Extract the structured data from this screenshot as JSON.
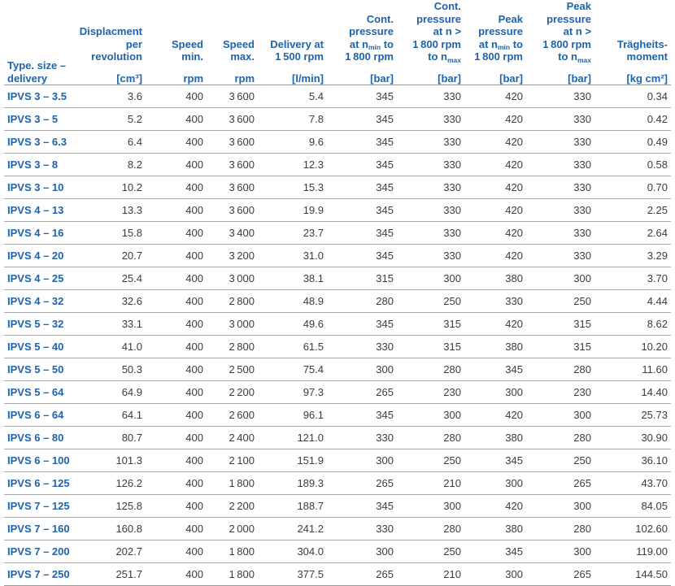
{
  "table": {
    "columns": [
      {
        "key": "type",
        "title_lines": [
          "Type. size –",
          "delivery"
        ],
        "unit": ""
      },
      {
        "key": "disp",
        "title_lines": [
          "Displacment",
          "per revolution"
        ],
        "unit": "[cm³]"
      },
      {
        "key": "smin",
        "title_lines": [
          "Speed",
          "min."
        ],
        "unit": "rpm"
      },
      {
        "key": "smax",
        "title_lines": [
          "Speed",
          "max."
        ],
        "unit": "rpm"
      },
      {
        "key": "del",
        "title_lines": [
          "Delivery at",
          "1 500 rpm"
        ],
        "unit": "[l/min]"
      },
      {
        "key": "cp1",
        "title_lines": [
          "Cont.",
          "pressure",
          "at n_min to",
          "1 800 rpm"
        ],
        "unit": "[bar]"
      },
      {
        "key": "cp2",
        "title_lines": [
          "Cont.",
          "pressure",
          "at n >",
          "1 800 rpm",
          "to n_max"
        ],
        "unit": "[bar]"
      },
      {
        "key": "pp1",
        "title_lines": [
          "Peak",
          "pressure",
          "at n_min to",
          "1 800 rpm"
        ],
        "unit": "[bar]"
      },
      {
        "key": "pp2",
        "title_lines": [
          "Peak",
          "pressure",
          "at n >",
          "1 800 rpm",
          "to n_max"
        ],
        "unit": "[bar]"
      },
      {
        "key": "tm",
        "title_lines": [
          "Trägheits-",
          "moment"
        ],
        "unit": "[kg cm²]"
      }
    ],
    "rows": [
      {
        "type": "IPVS 3 – 3.5",
        "disp": "3.6",
        "smin": "400",
        "smax": "3 600",
        "del": "5.4",
        "cp1": "345",
        "cp2": "330",
        "pp1": "420",
        "pp2": "330",
        "tm": "0.34"
      },
      {
        "type": "IPVS 3 – 5",
        "disp": "5.2",
        "smin": "400",
        "smax": "3 600",
        "del": "7.8",
        "cp1": "345",
        "cp2": "330",
        "pp1": "420",
        "pp2": "330",
        "tm": "0.42"
      },
      {
        "type": "IPVS 3 – 6.3",
        "disp": "6.4",
        "smin": "400",
        "smax": "3 600",
        "del": "9.6",
        "cp1": "345",
        "cp2": "330",
        "pp1": "420",
        "pp2": "330",
        "tm": "0.49"
      },
      {
        "type": "IPVS 3 – 8",
        "disp": "8.2",
        "smin": "400",
        "smax": "3 600",
        "del": "12.3",
        "cp1": "345",
        "cp2": "330",
        "pp1": "420",
        "pp2": "330",
        "tm": "0.58"
      },
      {
        "type": "IPVS 3 – 10",
        "disp": "10.2",
        "smin": "400",
        "smax": "3 600",
        "del": "15.3",
        "cp1": "345",
        "cp2": "330",
        "pp1": "420",
        "pp2": "330",
        "tm": "0.70"
      },
      {
        "type": "IPVS 4 – 13",
        "disp": "13.3",
        "smin": "400",
        "smax": "3 600",
        "del": "19.9",
        "cp1": "345",
        "cp2": "330",
        "pp1": "420",
        "pp2": "330",
        "tm": "2.25"
      },
      {
        "type": "IPVS 4 – 16",
        "disp": "15.8",
        "smin": "400",
        "smax": "3 400",
        "del": "23.7",
        "cp1": "345",
        "cp2": "330",
        "pp1": "420",
        "pp2": "330",
        "tm": "2.64"
      },
      {
        "type": "IPVS 4 – 20",
        "disp": "20.7",
        "smin": "400",
        "smax": "3 200",
        "del": "31.0",
        "cp1": "345",
        "cp2": "330",
        "pp1": "420",
        "pp2": "330",
        "tm": "3.29"
      },
      {
        "type": "IPVS 4 – 25",
        "disp": "25.4",
        "smin": "400",
        "smax": "3 000",
        "del": "38.1",
        "cp1": "315",
        "cp2": "300",
        "pp1": "380",
        "pp2": "300",
        "tm": "3.70"
      },
      {
        "type": "IPVS 4 – 32",
        "disp": "32.6",
        "smin": "400",
        "smax": "2 800",
        "del": "48.9",
        "cp1": "280",
        "cp2": "250",
        "pp1": "330",
        "pp2": "250",
        "tm": "4.44"
      },
      {
        "type": "IPVS 5 – 32",
        "disp": "33.1",
        "smin": "400",
        "smax": "3 000",
        "del": "49.6",
        "cp1": "345",
        "cp2": "315",
        "pp1": "420",
        "pp2": "315",
        "tm": "8.62"
      },
      {
        "type": "IPVS 5 – 40",
        "disp": "41.0",
        "smin": "400",
        "smax": "2 800",
        "del": "61.5",
        "cp1": "330",
        "cp2": "315",
        "pp1": "380",
        "pp2": "315",
        "tm": "10.20"
      },
      {
        "type": "IPVS 5 – 50",
        "disp": "50.3",
        "smin": "400",
        "smax": "2 500",
        "del": "75.4",
        "cp1": "300",
        "cp2": "280",
        "pp1": "345",
        "pp2": "280",
        "tm": "11.60"
      },
      {
        "type": "IPVS 5 – 64",
        "disp": "64.9",
        "smin": "400",
        "smax": "2 200",
        "del": "97.3",
        "cp1": "265",
        "cp2": "230",
        "pp1": "300",
        "pp2": "230",
        "tm": "14.40"
      },
      {
        "type": "IPVS 6 – 64",
        "disp": "64.1",
        "smin": "400",
        "smax": "2 600",
        "del": "96.1",
        "cp1": "345",
        "cp2": "300",
        "pp1": "420",
        "pp2": "300",
        "tm": "25.73"
      },
      {
        "type": "IPVS 6 – 80",
        "disp": "80.7",
        "smin": "400",
        "smax": "2 400",
        "del": "121.0",
        "cp1": "330",
        "cp2": "280",
        "pp1": "380",
        "pp2": "280",
        "tm": "30.90"
      },
      {
        "type": "IPVS 6 – 100",
        "disp": "101.3",
        "smin": "400",
        "smax": "2 100",
        "del": "151.9",
        "cp1": "300",
        "cp2": "250",
        "pp1": "345",
        "pp2": "250",
        "tm": "36.10"
      },
      {
        "type": "IPVS 6 – 125",
        "disp": "126.2",
        "smin": "400",
        "smax": "1 800",
        "del": "189.3",
        "cp1": "265",
        "cp2": "210",
        "pp1": "300",
        "pp2": "265",
        "tm": "43.70"
      },
      {
        "type": "IPVS 7 – 125",
        "disp": "125.8",
        "smin": "400",
        "smax": "2 200",
        "del": "188.7",
        "cp1": "345",
        "cp2": "300",
        "pp1": "420",
        "pp2": "300",
        "tm": "84.05"
      },
      {
        "type": "IPVS 7 – 160",
        "disp": "160.8",
        "smin": "400",
        "smax": "2 000",
        "del": "241.2",
        "cp1": "330",
        "cp2": "280",
        "pp1": "380",
        "pp2": "280",
        "tm": "102.60"
      },
      {
        "type": "IPVS 7 – 200",
        "disp": "202.7",
        "smin": "400",
        "smax": "1 800",
        "del": "304.0",
        "cp1": "300",
        "cp2": "250",
        "pp1": "345",
        "pp2": "300",
        "tm": "119.00"
      },
      {
        "type": "IPVS 7 – 250",
        "disp": "251.7",
        "smin": "400",
        "smax": "1 800",
        "del": "377.5",
        "cp1": "265",
        "cp2": "210",
        "pp1": "300",
        "pp2": "265",
        "tm": "144.50"
      }
    ]
  },
  "colors": {
    "heading_blue": "#1f63a8",
    "body_text": "#3c3c3c",
    "rule": "#a8a8a8",
    "background": "#ffffff"
  }
}
